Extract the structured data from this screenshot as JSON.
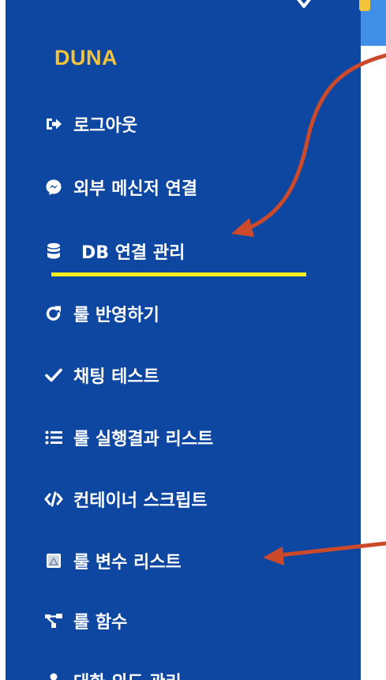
{
  "brand": {
    "name": "DUNA"
  },
  "sidebar": {
    "items": [
      {
        "label": "로그아웃",
        "icon": "sign-out-icon"
      },
      {
        "label": "외부 메신저 연결",
        "icon": "messenger-icon"
      },
      {
        "label": "DB 연결 관리",
        "icon": "database-icon"
      },
      {
        "label": "룰 반영하기",
        "icon": "redo-icon"
      },
      {
        "label": "채팅 테스트",
        "icon": "check-icon"
      },
      {
        "label": "룰 실행결과 리스트",
        "icon": "list-icon"
      },
      {
        "label": "컨테이너 스크립트",
        "icon": "code-icon"
      },
      {
        "label": "룰 변수 리스트",
        "icon": "image-icon"
      },
      {
        "label": "룰 함수",
        "icon": "sitemap-icon"
      },
      {
        "label": "대화 의도 관리",
        "icon": "user-icon"
      }
    ]
  },
  "colors": {
    "sidebar_bg": "#0d47a1",
    "brand": "#f3c43a",
    "highlight_underline": "#f7ef1c",
    "annotation_arrow": "#cc4a2a"
  }
}
